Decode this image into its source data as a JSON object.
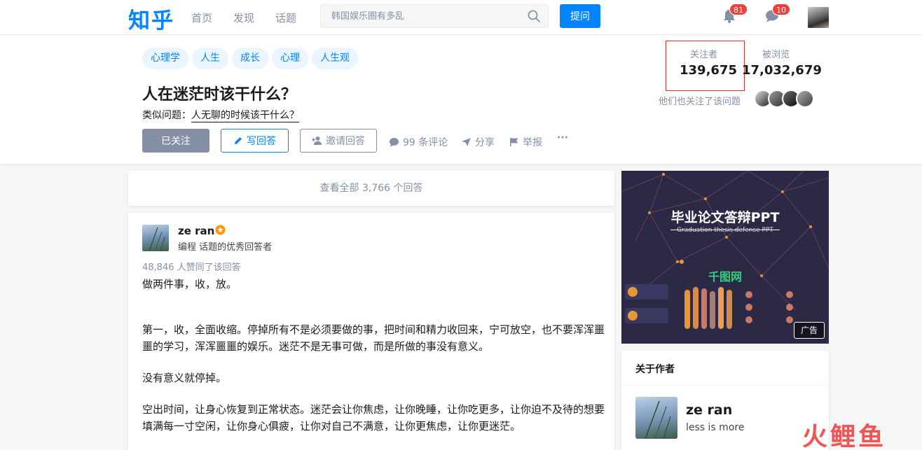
{
  "header": {
    "logo": "知乎",
    "nav": [
      "首页",
      "发现",
      "话题"
    ],
    "search_placeholder": "韩国娱乐圈有多乱",
    "ask_label": "提问",
    "notifications_count": "81",
    "messages_count": "10"
  },
  "question": {
    "topics": [
      "心理学",
      "人生",
      "成长",
      "心理",
      "人生观"
    ],
    "title": "人在迷茫时该干什么？",
    "similar_prefix": "类似问题：",
    "similar_link": "人无聊的时候该干什么？",
    "follow_label": "已关注",
    "write_label": "写回答",
    "invite_label": "邀请回答",
    "comments_label": "99 条评论",
    "share_label": "分享",
    "report_label": "举报",
    "more_label": "···",
    "followers_label": "关注者",
    "followers_count": "139,675",
    "views_label": "被浏览",
    "views_count": "17,032,679",
    "also_followed_label": "他们也关注了该问题"
  },
  "main": {
    "view_all_label": "查看全部 3,766 个回答",
    "answer": {
      "author": "ze ran",
      "headline": "编程 话题的优秀回答者",
      "votes": "48,846 人赞同了该回答",
      "paragraphs": [
        "做两件事，收，放。",
        "第一，收，全面收缩。停掉所有不是必须要做的事，把时间和精力收回来，宁可放空，也不要浑浑噩噩的学习，浑浑噩噩的娱乐。迷茫不是无事可做，而是所做的事没有意义。",
        "没有意义就停掉。",
        "空出时间，让身心恢复到正常状态。迷茫会让你焦虑，让你晚睡，让你吃更多，让你迫不及待的想要填满每一寸空闲，让你身心俱疲，让你对自己不满意，让你更焦虑，让你更迷茫。"
      ]
    }
  },
  "sidebar": {
    "ad": {
      "title": "毕业论文答辩PPT",
      "subtitle": "Graduation thesis defense PPT",
      "brand": "千图网",
      "tag": "广告"
    },
    "about": {
      "title": "关于作者",
      "name": "ze ran",
      "bio": "less is more"
    }
  },
  "watermark": "火鲤鱼",
  "colors": {
    "brand_blue": "#0084ff",
    "badge_red": "#f1403c",
    "muted": "#8590a6",
    "highlight_box": "#e3302b"
  }
}
